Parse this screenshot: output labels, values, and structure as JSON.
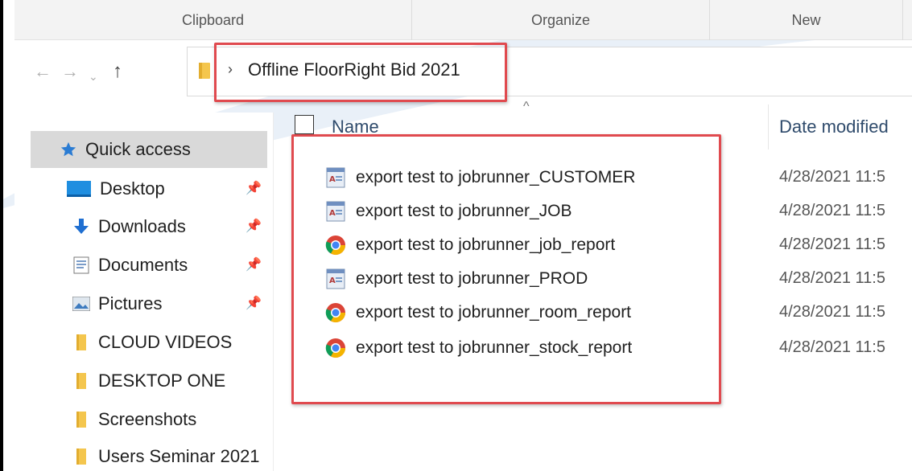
{
  "ribbon": {
    "groups": [
      "Clipboard",
      "Organize",
      "New"
    ]
  },
  "navigation": {
    "back_icon": "arrow-left-icon",
    "forward_icon": "arrow-right-icon",
    "recent_icon": "chevron-down-icon",
    "up_icon": "arrow-up-icon"
  },
  "address": {
    "path": "Offline FloorRight Bid 2021"
  },
  "sidebar": {
    "items": [
      {
        "label": "Quick access",
        "icon": "star-icon",
        "selected": true
      },
      {
        "label": "Desktop",
        "icon": "desktop-icon",
        "pinned": true
      },
      {
        "label": "Downloads",
        "icon": "download-icon",
        "pinned": true
      },
      {
        "label": "Documents",
        "icon": "document-icon",
        "pinned": true
      },
      {
        "label": "Pictures",
        "icon": "pictures-icon",
        "pinned": true
      },
      {
        "label": "CLOUD VIDEOS",
        "icon": "folder-icon"
      },
      {
        "label": "DESKTOP ONE",
        "icon": "folder-icon"
      },
      {
        "label": "Screenshots",
        "icon": "folder-icon"
      },
      {
        "label": "Users Seminar 2021",
        "icon": "folder-icon"
      }
    ]
  },
  "columns": {
    "name": "Name",
    "date_modified": "Date modified"
  },
  "files": [
    {
      "name": "export test to jobrunner_CUSTOMER",
      "icon": "access-file-icon",
      "date": "4/28/2021 11:5"
    },
    {
      "name": "export test to jobrunner_JOB",
      "icon": "access-file-icon",
      "date": "4/28/2021 11:5"
    },
    {
      "name": "export test to jobrunner_job_report",
      "icon": "chrome-icon",
      "date": "4/28/2021 11:5"
    },
    {
      "name": "export test to jobrunner_PROD",
      "icon": "access-file-icon",
      "date": "4/28/2021 11:5"
    },
    {
      "name": "export test to jobrunner_room_report",
      "icon": "chrome-icon",
      "date": "4/28/2021 11:5"
    },
    {
      "name": "export test to jobrunner_stock_report",
      "icon": "chrome-icon",
      "date": "4/28/2021 11:5"
    }
  ],
  "colors": {
    "highlight": "#e04a4f",
    "selected_bg": "#d9d9d9",
    "folder": "#f4c64e",
    "column_header": "#2e4a6b"
  }
}
